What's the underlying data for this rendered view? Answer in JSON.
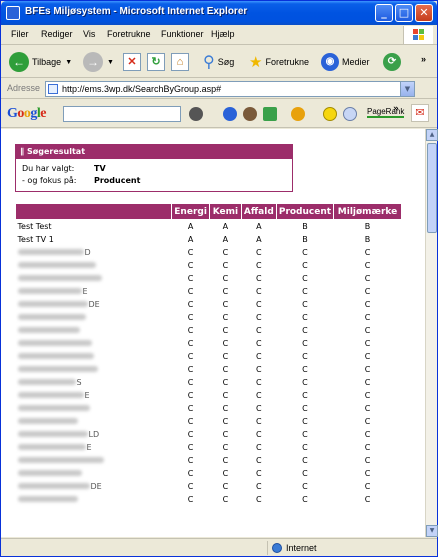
{
  "window": {
    "title": "BFEs Miljøsystem - Microsoft Internet Explorer",
    "minimize": "_",
    "maximize": "□",
    "close": "✕"
  },
  "menu": [
    "Filer",
    "Rediger",
    "Vis",
    "Foretrukne",
    "Funktioner",
    "Hjælp"
  ],
  "toolbar": {
    "back_label": "Tilbage",
    "search_label": "Søg",
    "favorites_label": "Foretrukne",
    "media_label": "Medier",
    "toolbar_chevron": "»"
  },
  "address": {
    "label": "Adresse",
    "url": "http://ems.3wp.dk/SearchByGroup.asp#"
  },
  "google": {
    "logo": [
      "G",
      "o",
      "o",
      "g",
      "l",
      "e"
    ],
    "pagerank": "PageRank",
    "toolbar_chevron": "»"
  },
  "result_box": {
    "header": "Søgeresultat",
    "selected_label": "Du har valgt:",
    "selected_value": "TV",
    "focus_label": "- og fokus på:",
    "focus_value": "Producent"
  },
  "table": {
    "columns": [
      "Energi",
      "Kemi",
      "Affald",
      "Producent",
      "Miljømærke"
    ],
    "rows": [
      {
        "name": "Test Test",
        "values": [
          "A",
          "A",
          "A",
          "B",
          "B"
        ]
      },
      {
        "name": "Test TV 1",
        "values": [
          "A",
          "A",
          "A",
          "B",
          "B"
        ]
      },
      {
        "name": "",
        "suffix": "D",
        "values": [
          "C",
          "C",
          "C",
          "C",
          "C"
        ]
      },
      {
        "name": "",
        "suffix": "",
        "values": [
          "C",
          "C",
          "C",
          "C",
          "C"
        ]
      },
      {
        "name": "",
        "suffix": "",
        "values": [
          "C",
          "C",
          "C",
          "C",
          "C"
        ]
      },
      {
        "name": "",
        "suffix": "E",
        "values": [
          "C",
          "C",
          "C",
          "C",
          "C"
        ]
      },
      {
        "name": "",
        "suffix": "DE",
        "values": [
          "C",
          "C",
          "C",
          "C",
          "C"
        ]
      },
      {
        "name": "",
        "suffix": "",
        "values": [
          "C",
          "C",
          "C",
          "C",
          "C"
        ]
      },
      {
        "name": "",
        "suffix": "",
        "values": [
          "C",
          "C",
          "C",
          "C",
          "C"
        ]
      },
      {
        "name": "",
        "suffix": "",
        "values": [
          "C",
          "C",
          "C",
          "C",
          "C"
        ]
      },
      {
        "name": "",
        "suffix": "",
        "values": [
          "C",
          "C",
          "C",
          "C",
          "C"
        ]
      },
      {
        "name": "",
        "suffix": "",
        "values": [
          "C",
          "C",
          "C",
          "C",
          "C"
        ]
      },
      {
        "name": "",
        "suffix": "S",
        "values": [
          "C",
          "C",
          "C",
          "C",
          "C"
        ]
      },
      {
        "name": "",
        "suffix": "E",
        "values": [
          "C",
          "C",
          "C",
          "C",
          "C"
        ]
      },
      {
        "name": "",
        "suffix": "",
        "values": [
          "C",
          "C",
          "C",
          "C",
          "C"
        ]
      },
      {
        "name": "",
        "suffix": "",
        "values": [
          "C",
          "C",
          "C",
          "C",
          "C"
        ]
      },
      {
        "name": "",
        "suffix": "LD",
        "values": [
          "C",
          "C",
          "C",
          "C",
          "C"
        ]
      },
      {
        "name": "",
        "suffix": "E",
        "values": [
          "C",
          "C",
          "C",
          "C",
          "C"
        ]
      },
      {
        "name": "",
        "suffix": "",
        "values": [
          "C",
          "C",
          "C",
          "C",
          "C"
        ]
      },
      {
        "name": "",
        "suffix": "",
        "values": [
          "C",
          "C",
          "C",
          "C",
          "C"
        ]
      },
      {
        "name": "",
        "suffix": "DE",
        "values": [
          "C",
          "C",
          "C",
          "C",
          "C"
        ]
      },
      {
        "name": "",
        "suffix": "",
        "values": [
          "C",
          "C",
          "C",
          "C",
          "C"
        ]
      }
    ]
  },
  "status": {
    "zone": "Internet"
  },
  "colors": {
    "accent": "#9c2d6a",
    "titlebar": "#0053e1"
  }
}
